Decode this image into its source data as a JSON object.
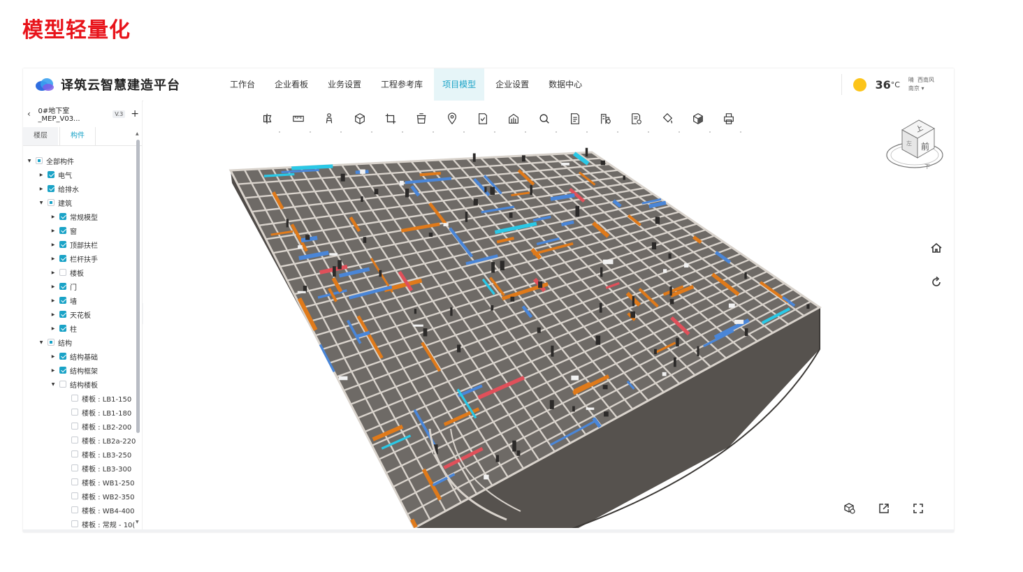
{
  "slide": {
    "title": "模型轻量化"
  },
  "header": {
    "brand": "译筑云智慧建造平台",
    "nav": [
      {
        "label": "工作台",
        "active": false
      },
      {
        "label": "企业看板",
        "active": false
      },
      {
        "label": "业务设置",
        "active": false
      },
      {
        "label": "工程参考库",
        "active": false
      },
      {
        "label": "项目模型",
        "active": true
      },
      {
        "label": "企业设置",
        "active": false
      },
      {
        "label": "数据中心",
        "active": false
      }
    ],
    "weather": {
      "temp": "36",
      "unit": "°C",
      "condition": "晴",
      "wind": "西南风",
      "city": "南京"
    }
  },
  "sidebar": {
    "project_name": "0#地下室_MEP_V03...",
    "version": "V.3",
    "tabs": [
      "楼层",
      "构件"
    ],
    "active_tab": "构件",
    "tree": [
      {
        "label": "全部构件",
        "level": 0,
        "state": "half",
        "expanded": true
      },
      {
        "label": "电气",
        "level": 1,
        "state": "on",
        "expanded": false
      },
      {
        "label": "给排水",
        "level": 1,
        "state": "on",
        "expanded": false
      },
      {
        "label": "建筑",
        "level": 1,
        "state": "half",
        "expanded": true
      },
      {
        "label": "常规模型",
        "level": 2,
        "state": "on",
        "expanded": false
      },
      {
        "label": "窗",
        "level": 2,
        "state": "on",
        "expanded": false
      },
      {
        "label": "顶部扶栏",
        "level": 2,
        "state": "on",
        "expanded": false
      },
      {
        "label": "栏杆扶手",
        "level": 2,
        "state": "on",
        "expanded": false
      },
      {
        "label": "楼板",
        "level": 2,
        "state": "off",
        "expanded": false
      },
      {
        "label": "门",
        "level": 2,
        "state": "on",
        "expanded": false
      },
      {
        "label": "墙",
        "level": 2,
        "state": "on",
        "expanded": false
      },
      {
        "label": "天花板",
        "level": 2,
        "state": "on",
        "expanded": false
      },
      {
        "label": "柱",
        "level": 2,
        "state": "on",
        "expanded": false
      },
      {
        "label": "结构",
        "level": 1,
        "state": "half",
        "expanded": true
      },
      {
        "label": "结构基础",
        "level": 2,
        "state": "on",
        "expanded": false
      },
      {
        "label": "结构框架",
        "level": 2,
        "state": "on",
        "expanded": false
      },
      {
        "label": "结构楼板",
        "level": 2,
        "state": "off",
        "expanded": true
      },
      {
        "label": "楼板 : LB1-150",
        "level": 3,
        "state": "off",
        "leaf": true
      },
      {
        "label": "楼板 : LB1-180",
        "level": 3,
        "state": "off",
        "leaf": true
      },
      {
        "label": "楼板 : LB2-200",
        "level": 3,
        "state": "off",
        "leaf": true
      },
      {
        "label": "楼板 : LB2a-220",
        "level": 3,
        "state": "off",
        "leaf": true
      },
      {
        "label": "楼板 : LB3-250",
        "level": 3,
        "state": "off",
        "leaf": true
      },
      {
        "label": "楼板 : LB3-300",
        "level": 3,
        "state": "off",
        "leaf": true
      },
      {
        "label": "楼板 : WB1-250",
        "level": 3,
        "state": "off",
        "leaf": true
      },
      {
        "label": "楼板 : WB2-350",
        "level": 3,
        "state": "off",
        "leaf": true
      },
      {
        "label": "楼板 : WB4-400",
        "level": 3,
        "state": "off",
        "leaf": true
      },
      {
        "label": "楼板 : 常规 - 10(",
        "level": 3,
        "state": "off",
        "leaf": true
      }
    ]
  },
  "viewer": {
    "tools": [
      "section-icon",
      "measure-icon",
      "roam-icon",
      "explode-icon",
      "crop-icon",
      "layer-icon",
      "location-icon",
      "mark-icon",
      "building-icon",
      "search-icon",
      "document-icon",
      "floor-icon",
      "property-icon",
      "paint-icon",
      "isolate-icon",
      "print-icon"
    ],
    "viewcube": {
      "top": "上",
      "front": "前",
      "left": "左",
      "bottom": "下"
    },
    "side_controls": [
      "home-icon",
      "rotate-icon"
    ],
    "bottom_controls": [
      "settings-cube-icon",
      "share-icon",
      "fullscreen-icon"
    ],
    "colors": {
      "slab": "#6e6a66",
      "grid": "#d9d3cc",
      "duct_orange": "#e07a1a",
      "pipe_blue": "#4a86d8",
      "cyan": "#2ac8e6",
      "red": "#e0505a"
    }
  }
}
